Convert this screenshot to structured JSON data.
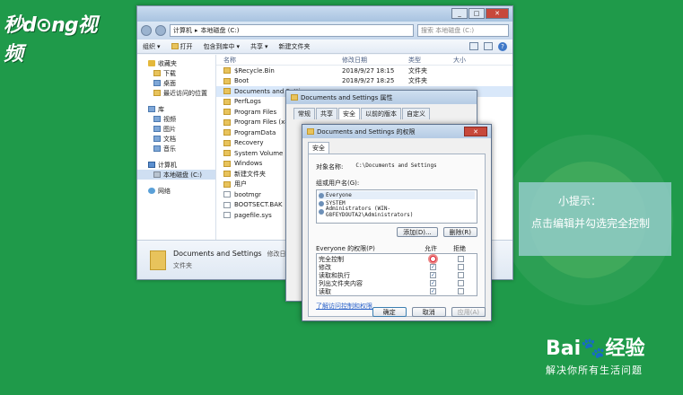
{
  "brand": {
    "logo_text": "秒d⊙ng视频"
  },
  "tip": {
    "title": "小提示：",
    "text": "点击编辑并勾选完全控制"
  },
  "baidu": {
    "logo": "Bai🐾经验",
    "slogan": "解决你所有生活问题"
  },
  "explorer": {
    "address": [
      "计算机",
      "本地磁盘 (C:)"
    ],
    "search_placeholder": "搜索 本地磁盘 (C:)",
    "toolbar": {
      "organize": "组织",
      "open": "打开",
      "include_in_library": "包含到库中",
      "share": "共享",
      "new_folder": "新建文件夹"
    },
    "nav": {
      "favorites": {
        "label": "收藏夹",
        "items": [
          "下载",
          "桌面",
          "最近访问的位置"
        ]
      },
      "libraries": {
        "label": "库",
        "items": [
          "视频",
          "图片",
          "文档",
          "音乐"
        ]
      },
      "computer": {
        "label": "计算机",
        "items": [
          "本地磁盘 (C:)"
        ]
      },
      "network": {
        "label": "网络"
      }
    },
    "columns": {
      "name": "名称",
      "date": "修改日期",
      "type": "类型",
      "size": "大小"
    },
    "rows": [
      {
        "name": "$Recycle.Bin",
        "date": "2018/9/27 18:15",
        "type": "文件夹",
        "icon": "folder"
      },
      {
        "name": "Boot",
        "date": "2018/9/27 18:25",
        "type": "文件夹",
        "icon": "folder"
      },
      {
        "name": "Documents and Settings",
        "date": "",
        "type": "",
        "icon": "folder"
      },
      {
        "name": "PerfLogs",
        "date": "",
        "type": "",
        "icon": "folder"
      },
      {
        "name": "Program Files",
        "date": "",
        "type": "",
        "icon": "folder"
      },
      {
        "name": "Program Files (x86)",
        "date": "",
        "type": "",
        "icon": "folder"
      },
      {
        "name": "ProgramData",
        "date": "",
        "type": "",
        "icon": "folder"
      },
      {
        "name": "Recovery",
        "date": "",
        "type": "",
        "icon": "folder"
      },
      {
        "name": "System Volume Info",
        "date": "",
        "type": "",
        "icon": "folder"
      },
      {
        "name": "Windows",
        "date": "",
        "type": "",
        "icon": "folder"
      },
      {
        "name": "新建文件夹",
        "date": "",
        "type": "",
        "icon": "folder"
      },
      {
        "name": "用户",
        "date": "",
        "type": "",
        "icon": "folder"
      },
      {
        "name": "bootmgr",
        "date": "",
        "type": "",
        "icon": "file"
      },
      {
        "name": "BOOTSECT.BAK",
        "date": "",
        "type": "",
        "icon": "file"
      },
      {
        "name": "pagefile.sys",
        "date": "",
        "type": "",
        "icon": "file"
      }
    ],
    "detail": {
      "name": "Documents and Settings",
      "modified": "修改日期: 20",
      "type": "文件夹"
    }
  },
  "props_dialog": {
    "title": "Documents and Settings 属性",
    "tabs": [
      "常规",
      "共享",
      "安全",
      "以前的版本",
      "自定义"
    ]
  },
  "perm_dialog": {
    "title": "Documents and Settings 的权限",
    "tab": "安全",
    "object_label": "对象名称:",
    "object_value": "C:\\Documents and Settings",
    "group_label": "组或用户名(G):",
    "users": [
      "Everyone",
      "SYSTEM",
      "Administrators (WIN-G8FEYDOUTA2\\Administrators)"
    ],
    "add_btn": "添加(D)...",
    "remove_btn": "删除(R)",
    "perm_header": "Everyone 的权限(P)",
    "allow": "允许",
    "deny": "拒绝",
    "permissions": [
      {
        "name": "完全控制"
      },
      {
        "name": "修改"
      },
      {
        "name": "读取和执行"
      },
      {
        "name": "列出文件夹内容"
      },
      {
        "name": "读取"
      }
    ],
    "link": "了解访问控制和权限",
    "ok": "确定",
    "cancel": "取消",
    "apply": "应用(A)"
  }
}
